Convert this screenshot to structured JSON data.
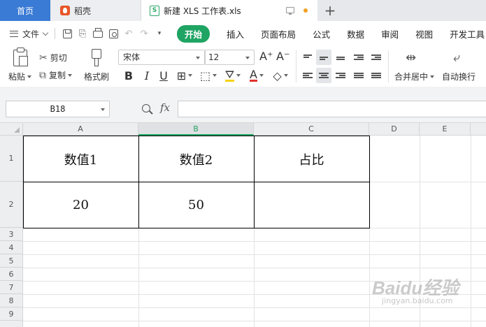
{
  "tabs": [
    {
      "label": "首页"
    },
    {
      "label": "稻壳"
    },
    {
      "label": "新建 XLS 工作表.xls",
      "icon_letter": "S"
    }
  ],
  "menu": {
    "file_label": "文件",
    "items": [
      "开始",
      "插入",
      "页面布局",
      "公式",
      "数据",
      "审阅",
      "视图",
      "开发工具"
    ]
  },
  "ribbon": {
    "paste": "粘贴",
    "cut": "剪切",
    "copy": "复制",
    "format_painter": "格式刷",
    "font_name": "宋体",
    "font_size": "12",
    "merge_center": "合并居中",
    "wrap_text": "自动换行",
    "bold": "B",
    "italic": "I",
    "underline": "U",
    "grow_font": "A⁺",
    "shrink_font": "A⁻",
    "font_color": "A"
  },
  "formula_bar": {
    "name_box": "B18",
    "fx": "fx",
    "formula": ""
  },
  "grid": {
    "columns": [
      "A",
      "B",
      "C",
      "D",
      "E"
    ],
    "selected_column": "B",
    "rows": [
      "1",
      "2",
      "3",
      "4",
      "5",
      "6",
      "7",
      "8",
      "9"
    ],
    "header_row": [
      "数值1",
      "数值2",
      "占比"
    ],
    "data_row": [
      "20",
      "50",
      ""
    ]
  },
  "colors": {
    "accent_green": "#1fa463",
    "home_tab_blue": "#3a7bd5"
  },
  "watermark": {
    "text": "Baidu经验",
    "sub": "jingyan.baidu.com"
  }
}
